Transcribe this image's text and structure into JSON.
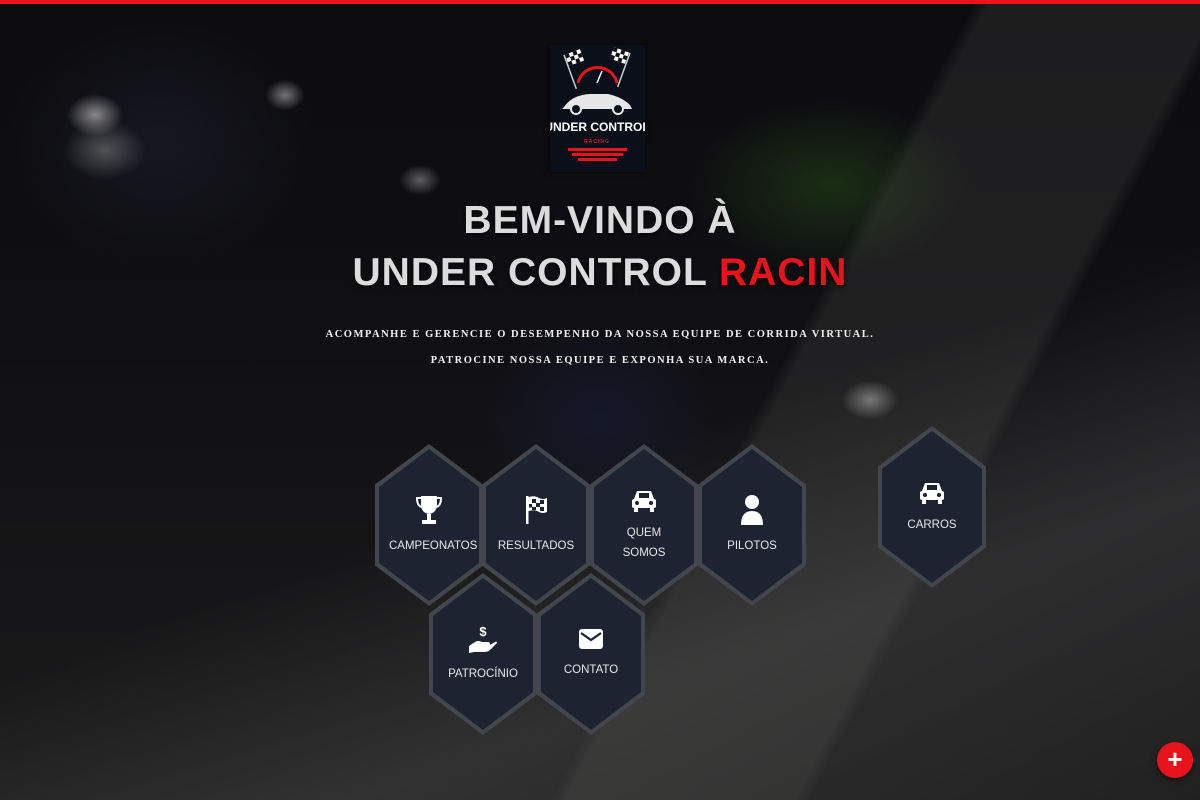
{
  "theme": {
    "accent": "#e8131b",
    "hex_fill": "#1d2331",
    "hex_border": "#43464c"
  },
  "logo": {
    "line1": "UNDER CONTROL",
    "line2": "RACING"
  },
  "hero": {
    "title_line1": "BEM-VINDO À",
    "title_line2_main": "UNDER CONTROL ",
    "title_line2_accent": "RACIN",
    "subtitle_line1": "ACOMPANHE E GERENCIE O DESEMPENHO DA NOSSA EQUIPE DE CORRIDA VIRTUAL.",
    "subtitle_line2": "PATROCINE NOSSA EQUIPE E EXPONHA SUA MARCA."
  },
  "menu": [
    {
      "label": "CAMPEONATOS",
      "icon": "trophy-icon"
    },
    {
      "label": "RESULTADOS",
      "icon": "checkered-flag-icon"
    },
    {
      "label": "QUEM SOMOS",
      "icon": "car-icon"
    },
    {
      "label": "PILOTOS",
      "icon": "user-icon"
    },
    {
      "label": "CARROS",
      "icon": "car-icon"
    },
    {
      "label": "PATROCÍNIO",
      "icon": "donate-hand-icon"
    },
    {
      "label": "CONTATO",
      "icon": "envelope-icon"
    }
  ],
  "fab": {
    "label": "+",
    "icon": "plus-icon"
  }
}
